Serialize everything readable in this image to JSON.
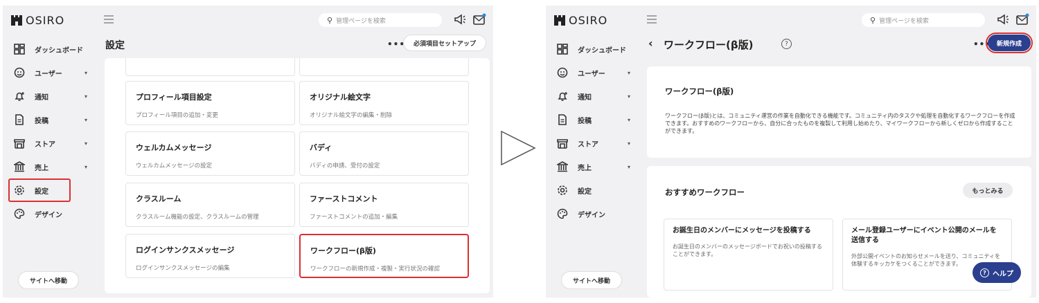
{
  "logo": "OSIRO",
  "search_placeholder": "管理ページを検索",
  "nav": [
    {
      "label": "ダッシュボード",
      "icon": "dashboard-icon",
      "chevron": ""
    },
    {
      "label": "ユーザー",
      "icon": "user-icon",
      "chevron": "▾"
    },
    {
      "label": "通知",
      "icon": "bell-icon",
      "chevron": "▾"
    },
    {
      "label": "投稿",
      "icon": "document-icon",
      "chevron": "▾"
    },
    {
      "label": "ストア",
      "icon": "store-icon",
      "chevron": "▾"
    },
    {
      "label": "売上",
      "icon": "bank-icon",
      "chevron": "▾"
    },
    {
      "label": "設定",
      "icon": "gear-icon",
      "chevron": ""
    },
    {
      "label": "デザイン",
      "icon": "palette-icon",
      "chevron": ""
    }
  ],
  "site_button": "サイトへ移動",
  "left": {
    "title": "設定",
    "more": "•••",
    "setup_button": "必須項目セットアップ",
    "cards": [
      {
        "title": "プロフィール項目設定",
        "desc": "プロフィール項目の追加・変更"
      },
      {
        "title": "オリジナル絵文字",
        "desc": "オリジナル絵文字の編集・削除"
      },
      {
        "title": "ウェルカムメッセージ",
        "desc": "ウェルカムメッセージの設定"
      },
      {
        "title": "バディ",
        "desc": "バディの申請、受付の設定"
      },
      {
        "title": "クラスルーム",
        "desc": "クラスルーム機能の設定、クラスルームの管理"
      },
      {
        "title": "ファーストコメント",
        "desc": "ファーストコメントの追加・編集"
      },
      {
        "title": "ログインサンクスメッセージ",
        "desc": "ログインサンクスメッセージの編集"
      },
      {
        "title": "ワークフロー(β版)",
        "desc": "ワークフローの新規作成・複製・実行状況の確認"
      }
    ]
  },
  "right": {
    "back": "‹",
    "title": "ワークフロー(β版)",
    "help_mark": "?",
    "more": "•••",
    "new_button": "新規作成",
    "intro_title": "ワークフロー(β版)",
    "intro_desc": "ワークフロー(β版)とは、コミュニティ運営の作業を自動化できる機能です。コミュニティ内のタスクや処理を自動化するワークフローを作成できます。おすすめのワークフローから、自分に合ったものを複製して利用し始めたり、マイワークフローから新しくゼロから作成することができます。",
    "recommended_title": "おすすめワークフロー",
    "see_more": "もっとみる",
    "workflows": [
      {
        "title": "お誕生日のメンバーにメッセージを投稿する",
        "desc": "お誕生日のメンバーのメッセージボードでお祝いの投稿することができます。"
      },
      {
        "title": "メール登録ユーザーにイベント公開のメールを送信する",
        "desc": "外部公開イベントのお知らせメールを送り、コミュニティを体験するキッカケをつくることができます。"
      }
    ],
    "help_button": "ヘルプ"
  },
  "colors": {
    "highlight": "#d93030",
    "primary": "#2b3f8f"
  }
}
